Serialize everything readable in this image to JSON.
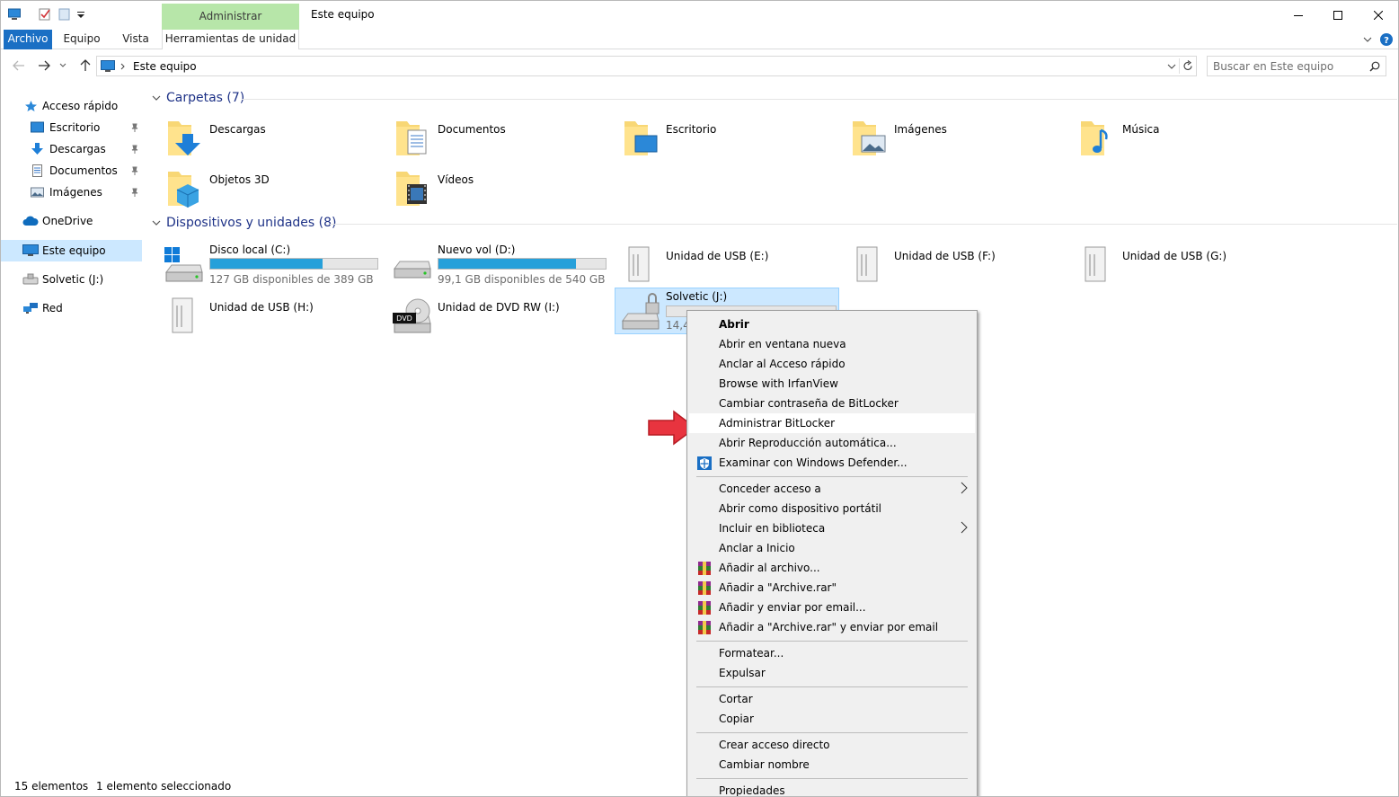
{
  "title_bar": {
    "window_title": "Este equipo",
    "context_tab_group": "Administrar",
    "quick_access_icons": [
      "computer-icon",
      "properties-icon",
      "new-folder-icon",
      "customize-qat-icon"
    ],
    "controls": [
      "minimize-icon",
      "maximize-icon",
      "close-icon"
    ]
  },
  "ribbon": {
    "tabs": [
      "Archivo",
      "Equipo",
      "Vista",
      "Herramientas de unidad"
    ],
    "active_tab": "Archivo",
    "accent_color": "#1a6fc4",
    "context_color": "#b7e6a9"
  },
  "address_bar": {
    "path": "Este equipo",
    "search_placeholder": "Buscar en Este equipo"
  },
  "nav_pane": {
    "items": [
      {
        "label": "Acceso rápido",
        "icon": "star-icon",
        "pinned": false
      },
      {
        "label": "Escritorio",
        "icon": "desktop-icon",
        "pinned": true
      },
      {
        "label": "Descargas",
        "icon": "download-icon",
        "pinned": true
      },
      {
        "label": "Documentos",
        "icon": "document-icon",
        "pinned": true
      },
      {
        "label": "Imágenes",
        "icon": "pictures-icon",
        "pinned": true
      },
      {
        "label": "OneDrive",
        "icon": "cloud-icon",
        "pinned": false
      },
      {
        "label": "Este equipo",
        "icon": "computer-icon",
        "pinned": false,
        "selected": true
      },
      {
        "label": "Solvetic (J:)",
        "icon": "usb-drive-icon",
        "pinned": false
      },
      {
        "label": "Red",
        "icon": "network-icon",
        "pinned": false
      }
    ]
  },
  "content": {
    "folders_header": "Carpetas (7)",
    "folders": [
      {
        "name": "Descargas",
        "icon": "downloads-folder-icon"
      },
      {
        "name": "Documentos",
        "icon": "documents-folder-icon"
      },
      {
        "name": "Escritorio",
        "icon": "desktop-folder-icon"
      },
      {
        "name": "Imágenes",
        "icon": "pictures-folder-icon"
      },
      {
        "name": "Música",
        "icon": "music-folder-icon"
      },
      {
        "name": "Objetos 3D",
        "icon": "3d-objects-folder-icon"
      },
      {
        "name": "Vídeos",
        "icon": "videos-folder-icon"
      }
    ],
    "devices_header": "Dispositivos y unidades (8)",
    "drives": [
      {
        "name": "Disco local (C:)",
        "free": "127 GB disponibles de 389 GB",
        "used_fraction": 0.67,
        "icon": "windows-drive-icon"
      },
      {
        "name": "Nuevo vol (D:)",
        "free": "99,1 GB disponibles de 540 GB",
        "used_fraction": 0.82,
        "icon": "hard-drive-icon"
      },
      {
        "name": "Unidad de USB (E:)",
        "icon": "usb-drive-icon"
      },
      {
        "name": "Unidad de USB (F:)",
        "icon": "usb-drive-icon"
      },
      {
        "name": "Unidad de USB (G:)",
        "icon": "usb-drive-icon"
      },
      {
        "name": "Unidad de USB (H:)",
        "icon": "usb-drive-icon"
      },
      {
        "name": "Unidad de DVD RW (I:)",
        "icon": "dvd-drive-icon",
        "badge": "DVD"
      },
      {
        "name": "Solvetic (J:)",
        "free_partial": "14,4",
        "icon": "bitlocker-drive-icon",
        "selected": true
      }
    ]
  },
  "context_menu": {
    "items": [
      {
        "label": "Abrir",
        "bold": true
      },
      {
        "label": "Abrir en ventana nueva"
      },
      {
        "label": "Anclar al Acceso rápido"
      },
      {
        "label": "Browse with IrfanView"
      },
      {
        "label": "Cambiar contraseña de BitLocker"
      },
      {
        "label": "Administrar BitLocker",
        "highlighted": true
      },
      {
        "label": "Abrir Reproducción automática..."
      },
      {
        "label": "Examinar con Windows Defender...",
        "icon": "defender-shield-icon"
      },
      {
        "label": "Conceder acceso a",
        "submenu": true
      },
      {
        "label": "Abrir como dispositivo portátil"
      },
      {
        "label": "Incluir en biblioteca",
        "submenu": true
      },
      {
        "label": "Anclar a Inicio"
      },
      {
        "label": "Añadir al archivo...",
        "icon": "winrar-icon"
      },
      {
        "label": "Añadir a \"Archive.rar\"",
        "icon": "winrar-icon"
      },
      {
        "label": "Añadir y enviar por email...",
        "icon": "winrar-icon"
      },
      {
        "label": "Añadir a \"Archive.rar\" y enviar por email",
        "icon": "winrar-icon"
      },
      {
        "label": "Formatear..."
      },
      {
        "label": "Expulsar"
      },
      {
        "label": "Cortar"
      },
      {
        "label": "Copiar"
      },
      {
        "label": "Crear acceso directo"
      },
      {
        "label": "Cambiar nombre"
      },
      {
        "label": "Propiedades"
      }
    ],
    "pointer_annotation": "red-arrow-icon"
  },
  "status_bar": {
    "count": "15 elementos",
    "selection": "1 elemento seleccionado"
  }
}
